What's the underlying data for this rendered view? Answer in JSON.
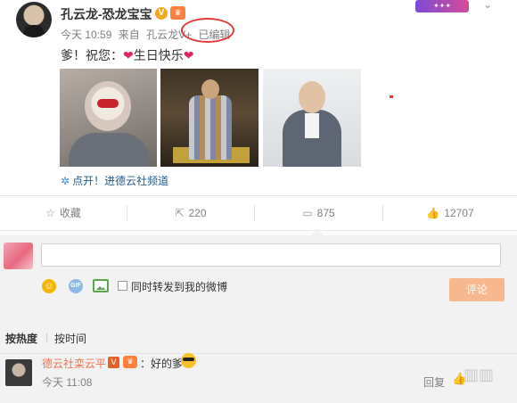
{
  "post": {
    "author": "孔云龙-恐龙宝宝",
    "verified_mark": "V",
    "time": "今天 10:59",
    "source_prefix": "来自",
    "source": "孔云龙V+",
    "edited_label": "已编辑",
    "text_prefix": "爹！祝您：",
    "text_highlight": "生日快乐",
    "heart_glyph": "❤",
    "channel_link": "点开！进德云社频道",
    "accent_color": "#eb7350"
  },
  "actions": {
    "favorite_label": "收藏",
    "repost_count": "220",
    "comment_count": "875",
    "like_count": "12707"
  },
  "composer": {
    "repost_checkbox_label": "同时转发到我的微博",
    "submit_label": "评论"
  },
  "comments": {
    "sort_hot": "按热度",
    "sort_time": "按时间",
    "items": [
      {
        "author": "德云社栾云平",
        "verified_mark": "V",
        "text": "：好的爹",
        "time": "今天 11:08",
        "reply_label": "回复"
      }
    ]
  }
}
